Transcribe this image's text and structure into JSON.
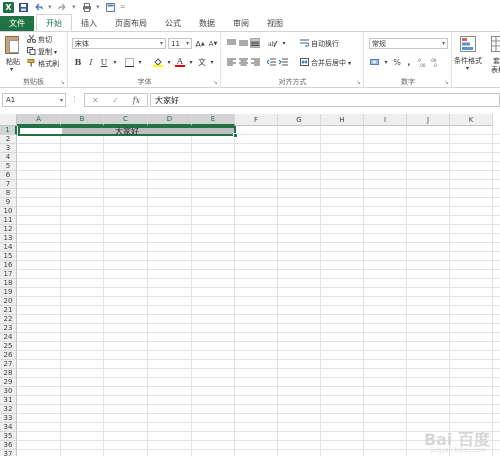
{
  "quick_access": {
    "app_icon_letter": "X",
    "icons": [
      "save-icon",
      "undo-icon",
      "redo-icon",
      "print-preview-icon",
      "customize-icon"
    ]
  },
  "tabs": {
    "file": "文件",
    "items": [
      "开始",
      "插入",
      "页面布局",
      "公式",
      "数据",
      "审阅",
      "视图"
    ],
    "active_index": 0
  },
  "ribbon": {
    "clipboard": {
      "paste": "粘贴",
      "cut": "剪切",
      "copy": "复制",
      "format_painter": "格式刷",
      "label": "剪贴板"
    },
    "font": {
      "name": "宋体",
      "size": "11",
      "grow": "A",
      "shrink": "A",
      "bold": "B",
      "italic": "I",
      "underline": "U",
      "wen": "文",
      "label": "字体"
    },
    "alignment": {
      "wrap_text": "自动换行",
      "merge_center": "合并后居中",
      "label": "对齐方式"
    },
    "number": {
      "format": "常规",
      "percent": "%",
      "comma": ",",
      "label": "数字"
    },
    "styles": {
      "conditional": "条件格式",
      "table_partial": "套",
      "table_partial2": "表格"
    }
  },
  "formula_bar": {
    "name_box": "A1",
    "cancel": "✕",
    "enter": "✓",
    "fx": "fx",
    "content": "大家好"
  },
  "sheet": {
    "columns": [
      "A",
      "B",
      "C",
      "D",
      "E",
      "F",
      "G",
      "H",
      "I",
      "J",
      "K"
    ],
    "rows": [
      "1",
      "2",
      "3",
      "4",
      "5",
      "6",
      "7",
      "8",
      "9",
      "10",
      "11",
      "12",
      "13",
      "14",
      "15",
      "16",
      "17",
      "18",
      "19",
      "20",
      "21",
      "22",
      "23",
      "24",
      "25",
      "26",
      "27",
      "28",
      "29",
      "30",
      "31",
      "32",
      "33",
      "34",
      "35",
      "36",
      "37",
      "38"
    ],
    "merged_text": "大家好"
  },
  "watermark": {
    "text": "Bai 百度",
    "sub": "jingyan.baidu.com"
  },
  "colors": {
    "accent": "#217346",
    "selection_fill": "#bfbfbf"
  }
}
